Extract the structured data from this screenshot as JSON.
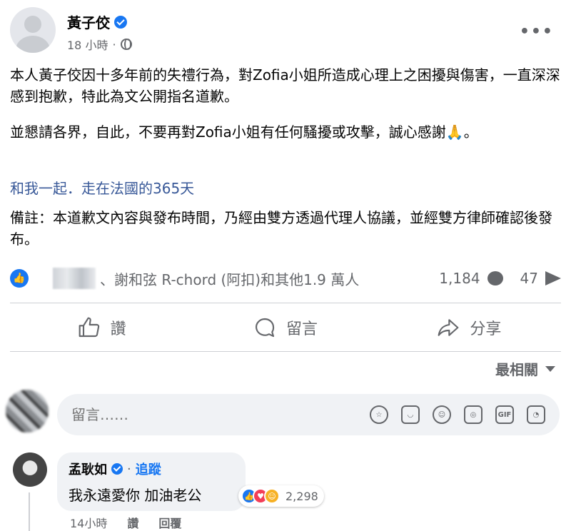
{
  "post": {
    "author": "黃子佼",
    "time": "18 小時",
    "separator": "·",
    "paragraph1": "本人黃子佼因十多年前的失禮行為，對Zofia小姐所造成心理上之困擾與傷害，一直深深感到抱歉，特此為文公開指名道歉。",
    "paragraph2": "並懇請各界，自此，不要再對Zofia小姐有任何騷擾或攻擊，誠心感謝🙏。",
    "link": "和我一起．走在法國的365天",
    "paragraph3": "備註：本道歉文內容與發布時間，乃經由雙方透過代理人協議，並經雙方律師確認後發布。"
  },
  "stats": {
    "reaction_names": "、謝和弦 R-chord (阿扣)和其他1.9 萬人",
    "comments": "1,184",
    "shares": "47"
  },
  "actions": {
    "like": "讚",
    "comment": "留言",
    "share": "分享"
  },
  "sort": {
    "label": "最相關"
  },
  "composer": {
    "placeholder": "留言……",
    "gif": "GIF"
  },
  "comment": {
    "author": "孟耿如",
    "follow": "追蹤",
    "separator": "·",
    "text": "我永遠愛你 加油老公",
    "reaction_count": "2,298",
    "time": "14小時",
    "like": "讚",
    "reply": "回覆"
  },
  "colors": {
    "brand_blue": "#1877f2",
    "link": "#385898",
    "secondary_text": "#65676b"
  }
}
